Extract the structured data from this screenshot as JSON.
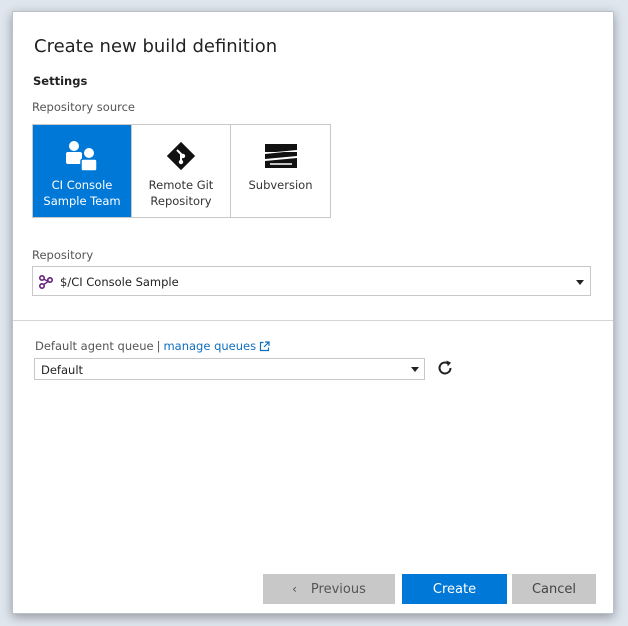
{
  "dialog": {
    "title": "Create new build definition",
    "settings_heading": "Settings"
  },
  "repository_source": {
    "label": "Repository source",
    "tiles": [
      {
        "label": "CI Console Sample Team",
        "icon": "team-icon",
        "selected": true
      },
      {
        "label": "Remote Git Repository",
        "icon": "git-icon",
        "selected": false
      },
      {
        "label": "Subversion",
        "icon": "subversion-icon",
        "selected": false
      }
    ]
  },
  "repository": {
    "label": "Repository",
    "value": "$/CI Console Sample",
    "icon": "repository-branch-icon"
  },
  "agent_queue": {
    "label": "Default agent queue",
    "separator": "|",
    "manage_link": "manage queues",
    "value": "Default"
  },
  "footer": {
    "previous_label": "Previous",
    "create_label": "Create",
    "cancel_label": "Cancel"
  },
  "colors": {
    "accent": "#0078d7",
    "link": "#106ebe",
    "button_disabled": "#c8c8c8"
  }
}
